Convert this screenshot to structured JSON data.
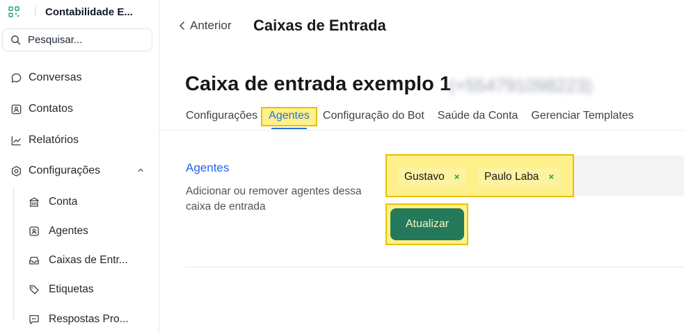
{
  "sidebar": {
    "brand_name": "Contabilidade E...",
    "search_placeholder": "Pesquisar...",
    "nav": {
      "conversas": "Conversas",
      "contatos": "Contatos",
      "relatorios": "Relatórios",
      "configuracoes": "Configurações"
    },
    "sub": {
      "conta": "Conta",
      "agentes": "Agentes",
      "caixas": "Caixas de Entr...",
      "etiquetas": "Etiquetas",
      "respostas": "Respostas Pro..."
    }
  },
  "header": {
    "back_label": "Anterior",
    "title": "Caixas de Entrada"
  },
  "inbox": {
    "name": "Caixa de entrada exemplo 1",
    "phone": "(+554791098223)"
  },
  "tabs": {
    "configuracoes": "Configurações",
    "agentes": "Agentes",
    "bot": "Configuração do Bot",
    "saude": "Saúde da Conta",
    "templates": "Gerenciar Templates"
  },
  "agents_section": {
    "title": "Agentes",
    "description": "Adicionar ou remover agentes dessa caixa de entrada",
    "selected": {
      "first": "Gustavo",
      "second": "Paulo Laba"
    },
    "remove_glyph": "×",
    "update_button": "Atualizar"
  },
  "colors": {
    "accent": "#2563eb",
    "primary_button": "#24795a",
    "highlight": "#fef08a"
  }
}
